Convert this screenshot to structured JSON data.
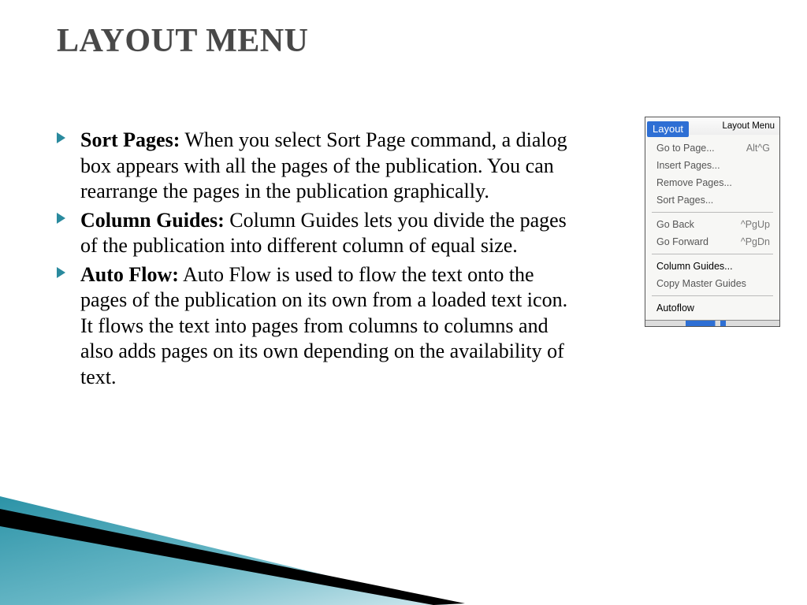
{
  "title": "LAYOUT MENU",
  "bullets": [
    {
      "bold": "Sort Pages:",
      "rest": " When you select Sort Page command, a dialog box appears with all the pages of the publication. You can rearrange the pages in the publication graphically."
    },
    {
      "bold": "Column Guides:",
      "rest": " Column Guides lets you divide the pages of the publication into different column of equal size."
    },
    {
      "bold": "Auto Flow:",
      "rest": " Auto Flow is used to flow the text onto the pages of the publication on its own from a loaded text icon. It flows  the text into pages from columns to columns and  also adds pages on its own depending on the availability of text."
    }
  ],
  "menu": {
    "tab_label": "Layout",
    "title": "Layout Menu",
    "section1": [
      {
        "label": "Go to Page...",
        "shortcut": "Alt^G"
      },
      {
        "label": "Insert Pages...",
        "shortcut": ""
      },
      {
        "label": "Remove Pages...",
        "shortcut": ""
      },
      {
        "label": "Sort Pages...",
        "shortcut": ""
      }
    ],
    "section2": [
      {
        "label": "Go Back",
        "shortcut": "^PgUp"
      },
      {
        "label": "Go Forward",
        "shortcut": "^PgDn"
      }
    ],
    "section3": [
      {
        "label": "Column Guides...",
        "shortcut": "",
        "enabled": true
      },
      {
        "label": "Copy Master Guides",
        "shortcut": "",
        "enabled": false
      }
    ],
    "section4": [
      {
        "label": "Autoflow",
        "shortcut": "",
        "enabled": true
      }
    ]
  }
}
